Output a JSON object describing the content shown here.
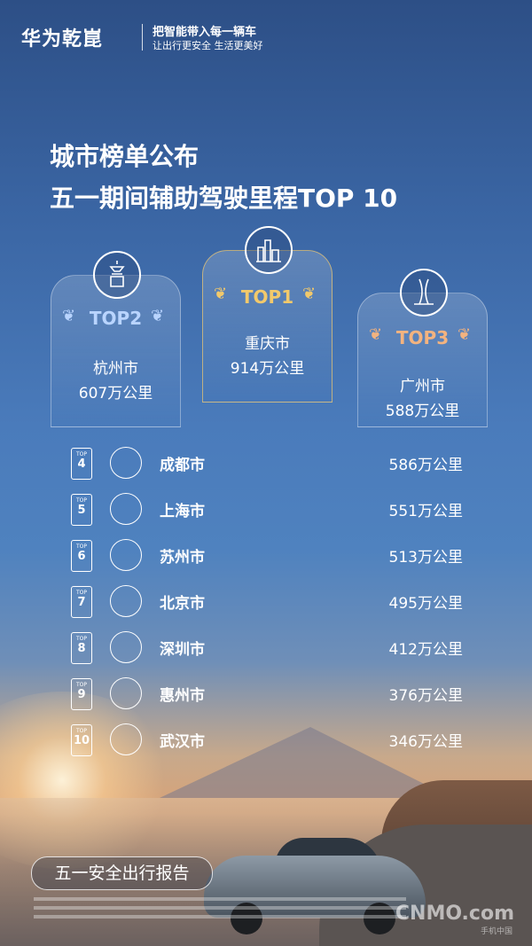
{
  "header": {
    "brand": "华为乾崑",
    "slogan_line1": "把智能带入每一辆车",
    "slogan_line2": "让出行更安全  生活更美好"
  },
  "title": {
    "line1": "城市榜单公布",
    "line2": "五一期间辅助驾驶里程TOP 10"
  },
  "podium": [
    {
      "rank": "TOP2",
      "city": "杭州市",
      "distance": "607万公里",
      "icon": "pagoda-icon",
      "color": "#b9d4ff"
    },
    {
      "rank": "TOP1",
      "city": "重庆市",
      "distance": "914万公里",
      "icon": "skyline-icon",
      "color": "#f2c96b"
    },
    {
      "rank": "TOP3",
      "city": "广州市",
      "distance": "588万公里",
      "icon": "canton-tower-icon",
      "color": "#f3b37f"
    }
  ],
  "ranking": [
    {
      "badge_label": "TOP",
      "rank": "4",
      "city": "成都市",
      "distance": "586万公里",
      "icon": "gate-icon"
    },
    {
      "badge_label": "TOP",
      "rank": "5",
      "city": "上海市",
      "distance": "551万公里",
      "icon": "pearl-tower-icon"
    },
    {
      "badge_label": "TOP",
      "rank": "6",
      "city": "苏州市",
      "distance": "513万公里",
      "icon": "garden-icon"
    },
    {
      "badge_label": "TOP",
      "rank": "7",
      "city": "北京市",
      "distance": "495万公里",
      "icon": "temple-of-heaven-icon"
    },
    {
      "badge_label": "TOP",
      "rank": "8",
      "city": "深圳市",
      "distance": "412万公里",
      "icon": "towers-icon"
    },
    {
      "badge_label": "TOP",
      "rank": "9",
      "city": "惠州市",
      "distance": "376万公里",
      "icon": "pagoda-icon"
    },
    {
      "badge_label": "TOP",
      "rank": "10",
      "city": "武汉市",
      "distance": "346万公里",
      "icon": "yellow-crane-tower-icon"
    }
  ],
  "report_button": "五一安全出行报告",
  "watermark": {
    "main": "CNMO.com",
    "sub": "手机中国"
  }
}
